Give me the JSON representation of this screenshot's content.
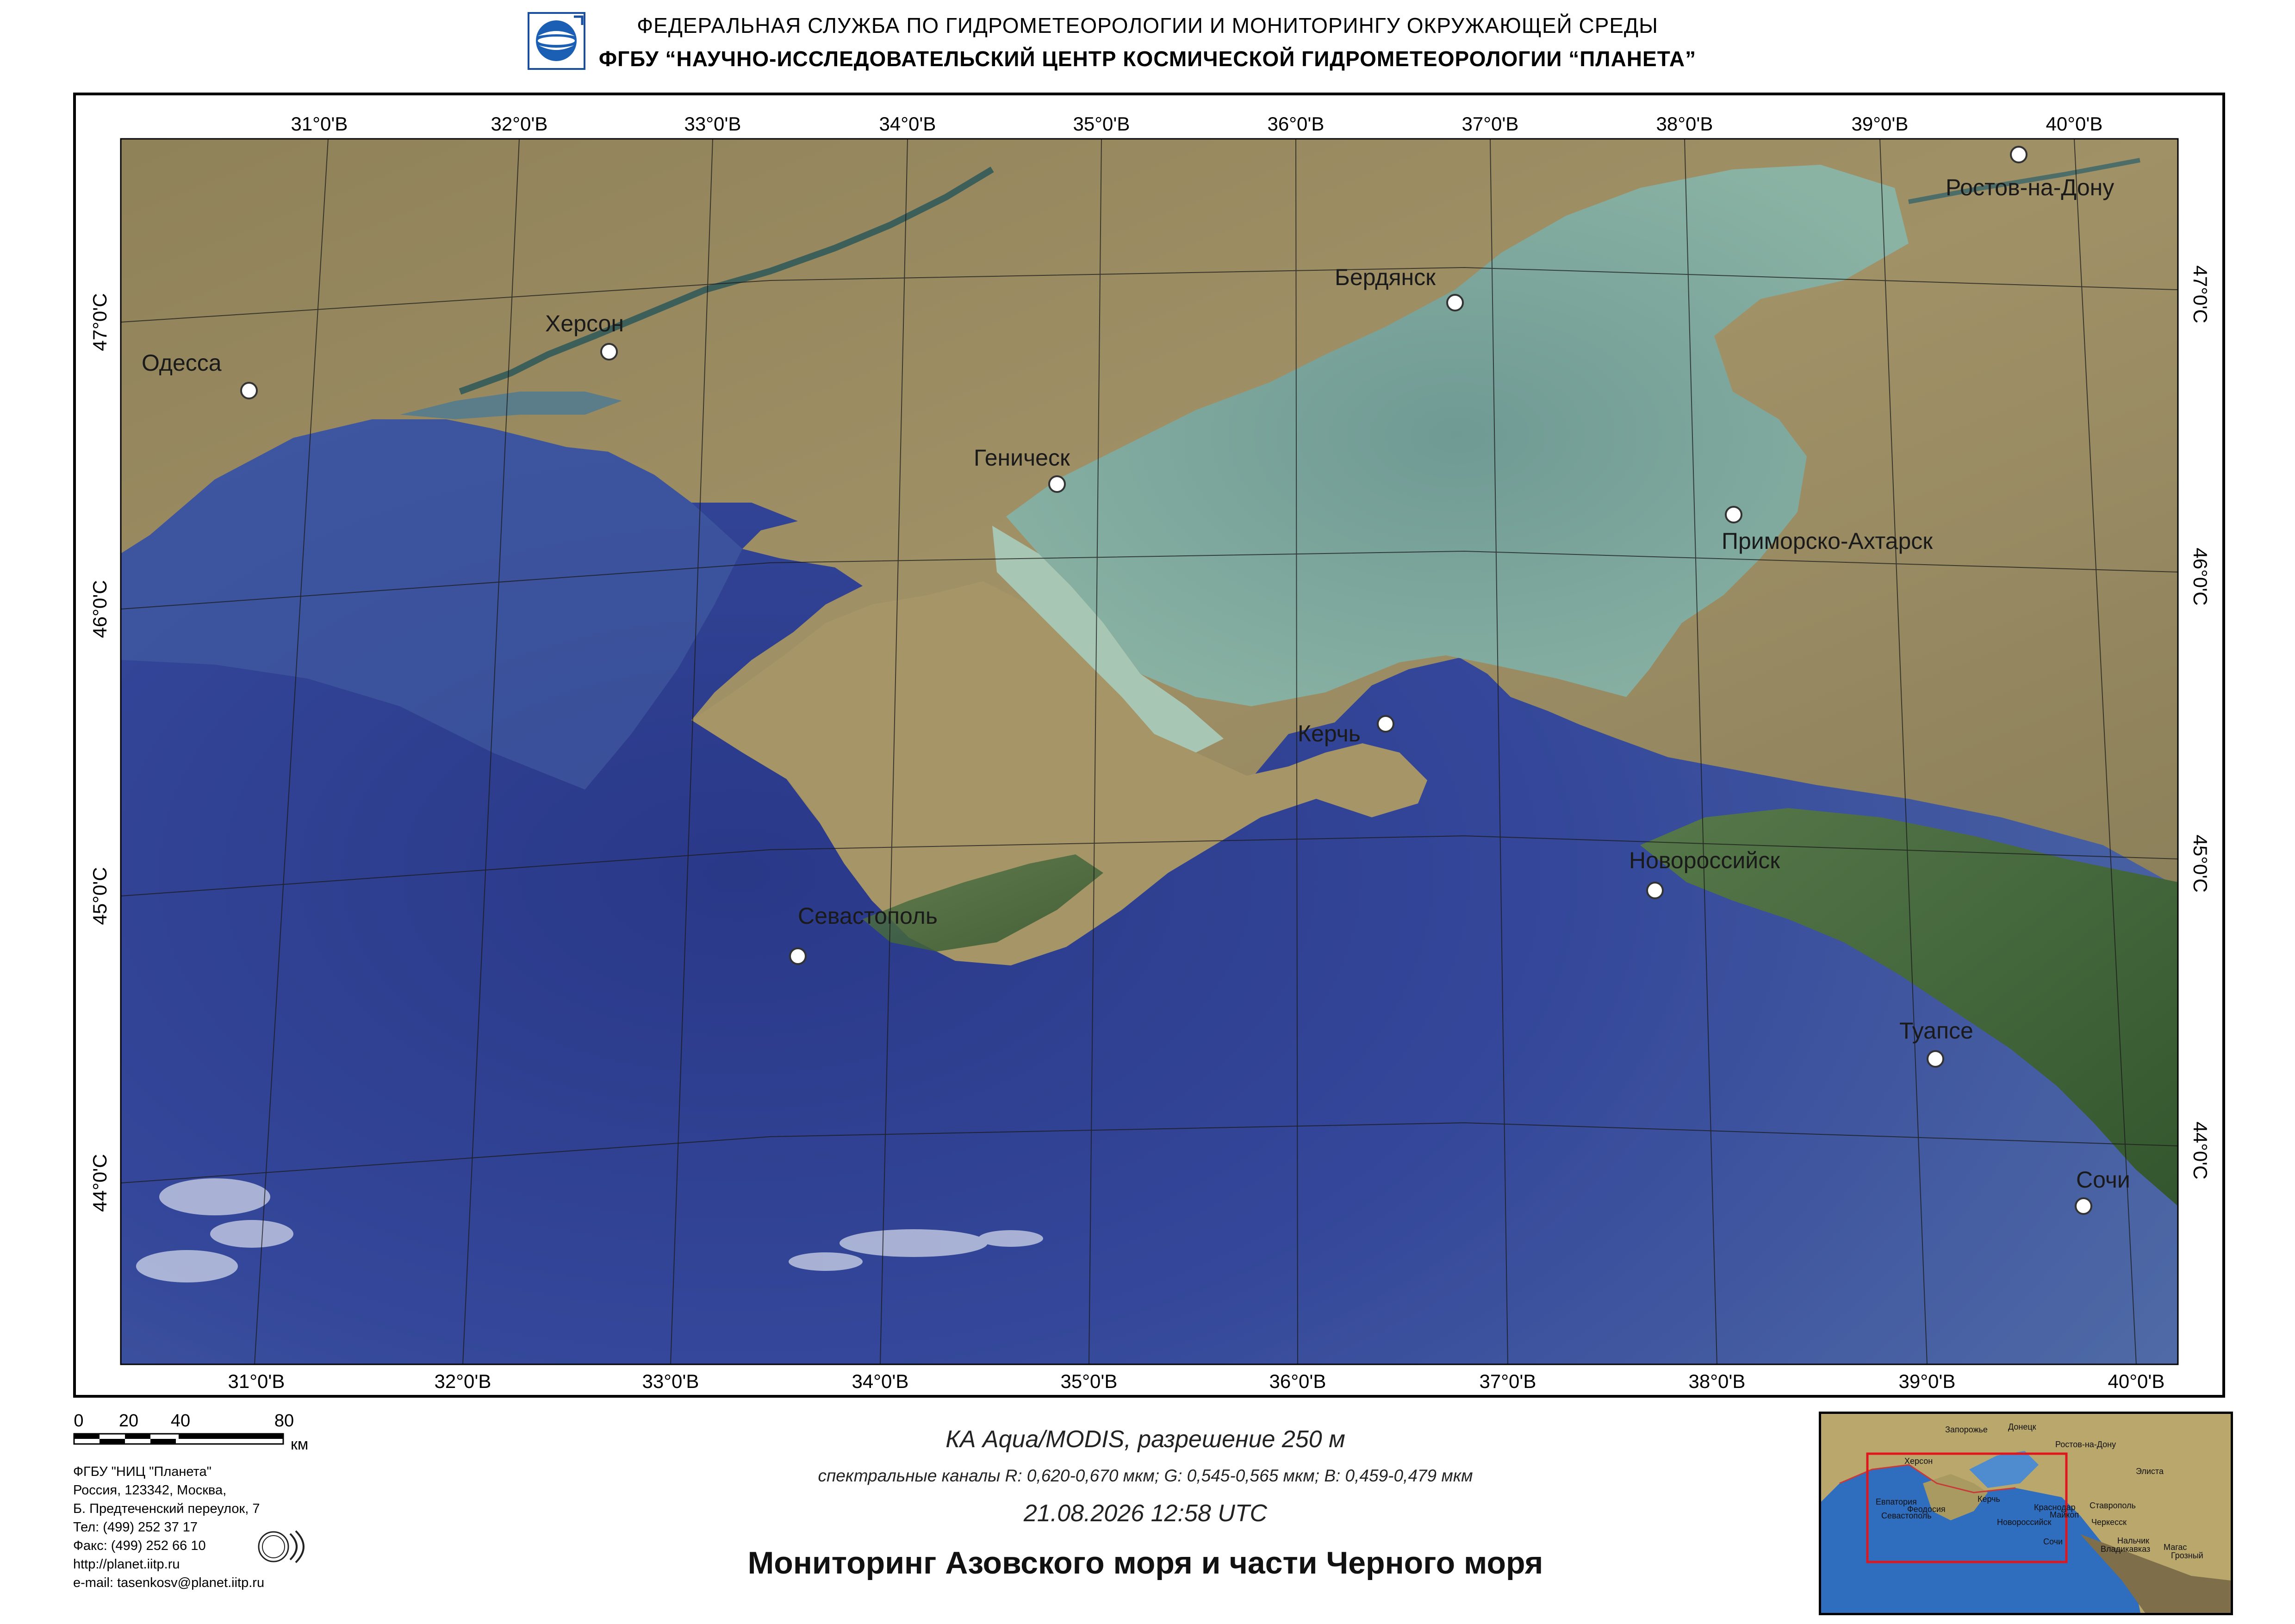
{
  "header": {
    "agency": "ФЕДЕРАЛЬНАЯ  СЛУЖБА  ПО ГИДРОМЕТЕОРОЛОГИИ И МОНИТОРИНГУ ОКРУЖАЮЩЕЙ СРЕДЫ",
    "center": "ФГБУ “НАУЧНО-ИССЛЕДОВАТЕЛЬСКИЙ ЦЕНТР КОСМИЧЕСКОЙ ГИДРОМЕТЕОРОЛОГИИ “ПЛАНЕТА”"
  },
  "map": {
    "longitude_labels_top": [
      "31°0'В",
      "32°0'В",
      "33°0'В",
      "34°0'В",
      "35°0'В",
      "36°0'В",
      "37°0'В",
      "38°0'В",
      "39°0'В",
      "40°0'В"
    ],
    "longitude_labels_bottom": [
      "31°0'В",
      "32°0'В",
      "33°0'В",
      "34°0'В",
      "35°0'В",
      "36°0'В",
      "37°0'В",
      "38°0'В",
      "39°0'В",
      "40°0'В"
    ],
    "latitude_labels_left": [
      "47°0'С",
      "46°0'С",
      "45°0'С",
      "44°0'С"
    ],
    "latitude_labels_right": [
      "47°0'С",
      "46°0'С",
      "45°0'С",
      "44°0'С"
    ],
    "cities": {
      "odessa": "Одесса",
      "kherson": "Херсон",
      "genichesk": "Геническ",
      "berdyansk": "Бердянск",
      "rostov": "Ростов-на-Дону",
      "primorsko": "Приморско-Ахтарск",
      "kerch": "Керчь",
      "sevastopol": "Севастополь",
      "novorossiysk": "Новороссийск",
      "tuapse": "Туапсе",
      "sochi": "Сочи"
    },
    "colors": {
      "deep_sea": "#2a3d8c",
      "shallow_sea": "#4d6aa8",
      "azov_water": "#7fa69a",
      "land": "#9b8a62",
      "forest": "#3f6a38"
    }
  },
  "scale_bar": {
    "ticks": [
      "0",
      "20",
      "40",
      "80"
    ],
    "unit": "км"
  },
  "organization": {
    "lines": [
      "ФГБУ \"НИЦ \"Планета\"",
      "Россия, 123342,  Москва,",
      "Б. Предтеченский переулок, 7",
      "Тел: (499) 252 37 17",
      "Факс: (499) 252 66 10",
      "http://planet.iitp.ru",
      "e-mail: tasenkosv@planet.iitp.ru"
    ]
  },
  "caption": {
    "satellite": "КА Aqua/MODIS, разрешение 250 м",
    "channels": "спектральные каналы R: 0,620-0,670 мкм; G: 0,545-0,565 мкм;  B: 0,459-0,479 мкм",
    "datetime": "21.08.2026   12:58 UTC",
    "title": "Мониторинг Азовского моря и части Черного моря"
  },
  "inset": {
    "labels": {
      "zaporozhye": "Запорожье",
      "donetsk": "Донецк",
      "rostov": "Ростов-на-Дону",
      "kherson": "Херсон",
      "elista": "Элиста",
      "evpatoria": "Евпатория",
      "kerch": "Керчь",
      "krasnodar": "Краснодар",
      "stavropol": "Ставрополь",
      "feodosia": "Феодосия",
      "sevastopol": "Севастополь",
      "maikop": "Майкоп",
      "cherkessk": "Черкесск",
      "novorossiysk": "Новороссийск",
      "nalchik": "Нальчик",
      "sochi": "Сочи",
      "vladikavkaz": "Владикавказ",
      "magas": "Магас",
      "grozny": "Грозный"
    }
  }
}
